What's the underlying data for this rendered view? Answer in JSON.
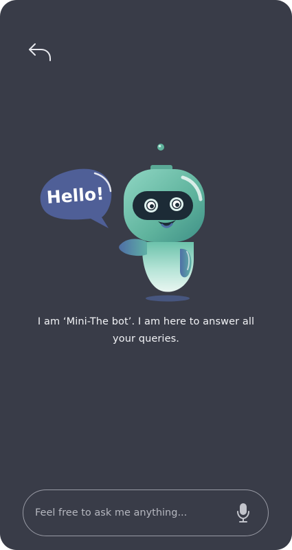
{
  "colors": {
    "background": "#393c48",
    "bot_body": "#6ac0a8",
    "speech_bubble": "#4f5f97",
    "text": "#f2f3f6"
  },
  "header": {
    "back_icon": "back-arrow-icon"
  },
  "bot": {
    "bubble_text": "Hello!",
    "intro": "I am ‘Mini-The bot’. I am here to answer all your queries."
  },
  "input": {
    "placeholder": "Feel free to ask me anything...",
    "value": "",
    "mic_icon": "microphone-icon"
  }
}
